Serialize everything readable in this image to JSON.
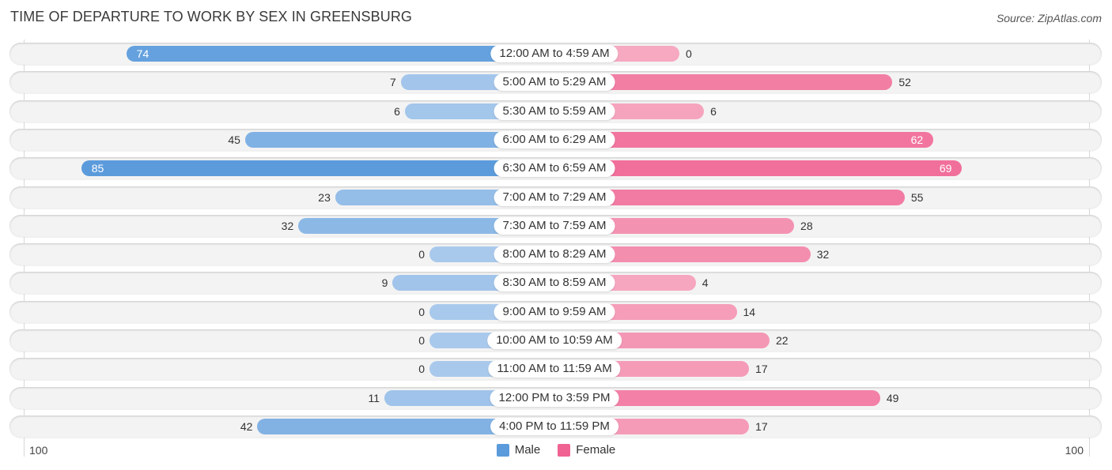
{
  "chart_data": {
    "type": "bar",
    "orientation": "horizontal-diverging",
    "title": "TIME OF DEPARTURE TO WORK BY SEX IN GREENSBURG",
    "source": "Source: ZipAtlas.com",
    "categories": [
      "12:00 AM to 4:59 AM",
      "5:00 AM to 5:29 AM",
      "5:30 AM to 5:59 AM",
      "6:00 AM to 6:29 AM",
      "6:30 AM to 6:59 AM",
      "7:00 AM to 7:29 AM",
      "7:30 AM to 7:59 AM",
      "8:00 AM to 8:29 AM",
      "8:30 AM to 8:59 AM",
      "9:00 AM to 9:59 AM",
      "10:00 AM to 10:59 AM",
      "11:00 AM to 11:59 AM",
      "12:00 PM to 3:59 PM",
      "4:00 PM to 11:59 PM"
    ],
    "series": [
      {
        "name": "Male",
        "color": "#5b9bdc",
        "light_color": "#a9c9ec",
        "values": [
          74,
          7,
          6,
          45,
          85,
          23,
          32,
          0,
          9,
          0,
          0,
          0,
          11,
          42
        ]
      },
      {
        "name": "Female",
        "color": "#f06292",
        "light_color": "#f6a9c1",
        "values": [
          0,
          52,
          6,
          62,
          69,
          55,
          28,
          32,
          4,
          14,
          22,
          17,
          49,
          17
        ]
      }
    ],
    "axis": {
      "left_label": "100",
      "right_label": "100",
      "xlim": [
        -100,
        100
      ]
    },
    "legend": {
      "position": "bottom-center",
      "entries": [
        "Male",
        "Female"
      ]
    },
    "grid": false
  }
}
